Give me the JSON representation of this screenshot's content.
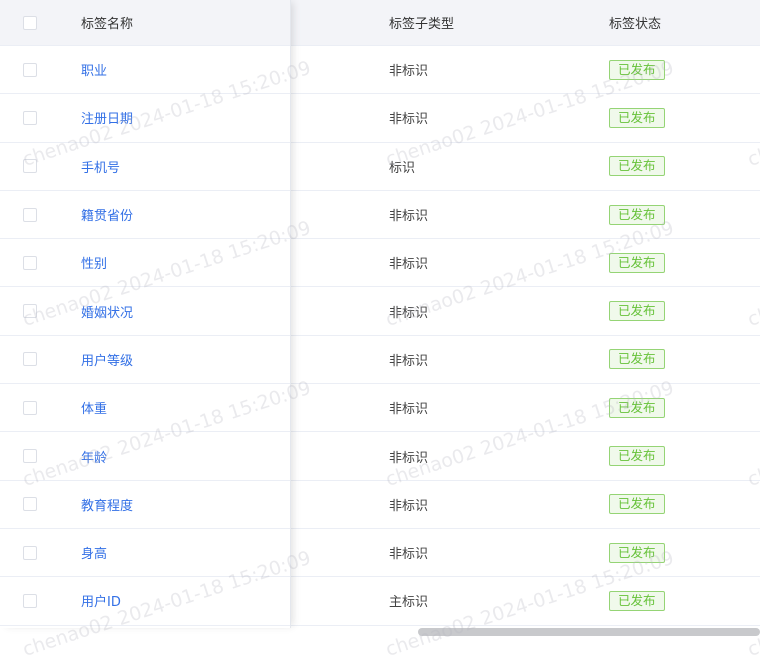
{
  "table": {
    "headers": {
      "name": "标签名称",
      "subtype": "标签子类型",
      "status": "标签状态"
    },
    "rows": [
      {
        "name": "职业",
        "subtype": "非标识",
        "status": "已发布"
      },
      {
        "name": "注册日期",
        "subtype": "非标识",
        "status": "已发布"
      },
      {
        "name": "手机号",
        "subtype": "标识",
        "status": "已发布"
      },
      {
        "name": "籍贯省份",
        "subtype": "非标识",
        "status": "已发布"
      },
      {
        "name": "性别",
        "subtype": "非标识",
        "status": "已发布"
      },
      {
        "name": "婚姻状况",
        "subtype": "非标识",
        "status": "已发布"
      },
      {
        "name": "用户等级",
        "subtype": "非标识",
        "status": "已发布"
      },
      {
        "name": "体重",
        "subtype": "非标识",
        "status": "已发布"
      },
      {
        "name": "年龄",
        "subtype": "非标识",
        "status": "已发布"
      },
      {
        "name": "教育程度",
        "subtype": "非标识",
        "status": "已发布"
      },
      {
        "name": "身高",
        "subtype": "非标识",
        "status": "已发布"
      },
      {
        "name": "用户ID",
        "subtype": "主标识",
        "status": "已发布"
      }
    ]
  },
  "watermark": {
    "text": "chenao02 2024-01-18 15:20:09"
  },
  "colors": {
    "link": "#3370e6",
    "tag_text": "#67c23a",
    "tag_border": "#95d475",
    "tag_bg": "#f0f9eb",
    "header_bg": "#f3f4f8"
  }
}
